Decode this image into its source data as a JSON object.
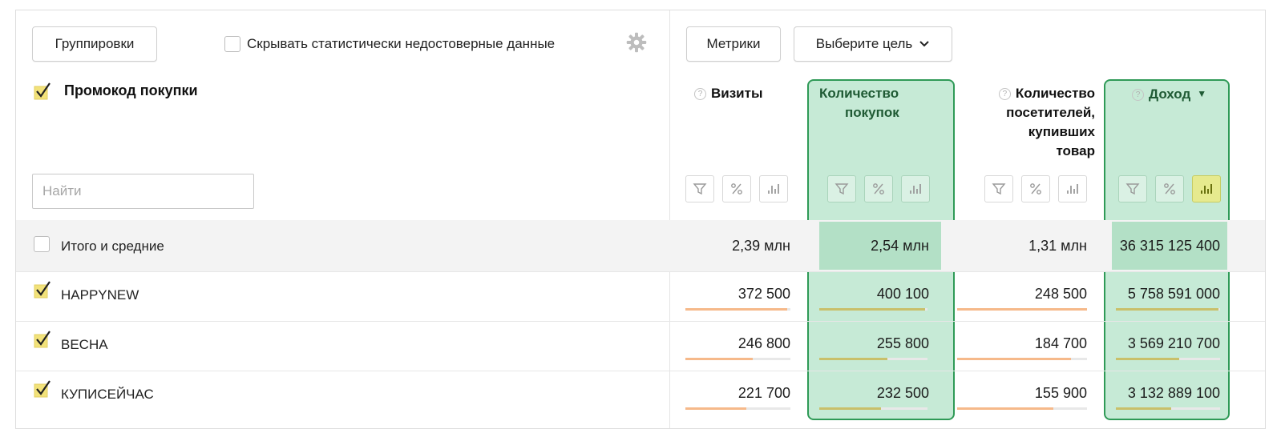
{
  "toolbar": {
    "groupings_label": "Группировки",
    "hide_unreliable_label": "Скрывать статистически недостоверные данные",
    "metrics_label": "Метрики",
    "goal_select_label": "Выберите цель"
  },
  "dimension": {
    "title": "Промокод покупки",
    "search_placeholder": "Найти"
  },
  "columns": [
    {
      "id": "visits",
      "label_lines": [
        "Визиты"
      ],
      "help": "?",
      "highlighted": false,
      "sorted": false
    },
    {
      "id": "purchases",
      "label_lines": [
        "Количество",
        "покупок"
      ],
      "help": "",
      "highlighted": true,
      "sorted": false
    },
    {
      "id": "buyers",
      "label_lines": [
        "Количество",
        "посетителей,",
        "купивших",
        "товар"
      ],
      "help": "?",
      "highlighted": false,
      "sorted": false
    },
    {
      "id": "revenue",
      "label_lines": [
        "Доход"
      ],
      "help": "?",
      "highlighted": true,
      "sorted": true,
      "sort_arrow": "▼"
    }
  ],
  "totals": {
    "label": "Итого и средние",
    "values": [
      "2,39 млн",
      "2,54 млн",
      "1,31 млн",
      "36 315 125 400"
    ]
  },
  "rows": [
    {
      "label": "HAPPYNEW",
      "checked": true,
      "values": [
        "372 500",
        "400 100",
        "248 500",
        "5 758 591 000"
      ],
      "shares": [
        0.156,
        0.158,
        0.19,
        0.159
      ]
    },
    {
      "label": "ВЕСНА",
      "checked": true,
      "values": [
        "246 800",
        "255 800",
        "184 700",
        "3 569 210 700"
      ],
      "shares": [
        0.103,
        0.101,
        0.141,
        0.098
      ]
    },
    {
      "label": "КУПИСЕЙЧАС",
      "checked": true,
      "values": [
        "221 700",
        "232 500",
        "155 900",
        "3 132 889 100"
      ],
      "shares": [
        0.093,
        0.092,
        0.119,
        0.086
      ]
    }
  ],
  "colors": {
    "highlight_fill": "#c6ead6",
    "highlight_border": "#2f9a57",
    "bar_orange": "#f6b98a",
    "bar_olive": "#c9c06a",
    "check_fill": "#f2e27a"
  }
}
